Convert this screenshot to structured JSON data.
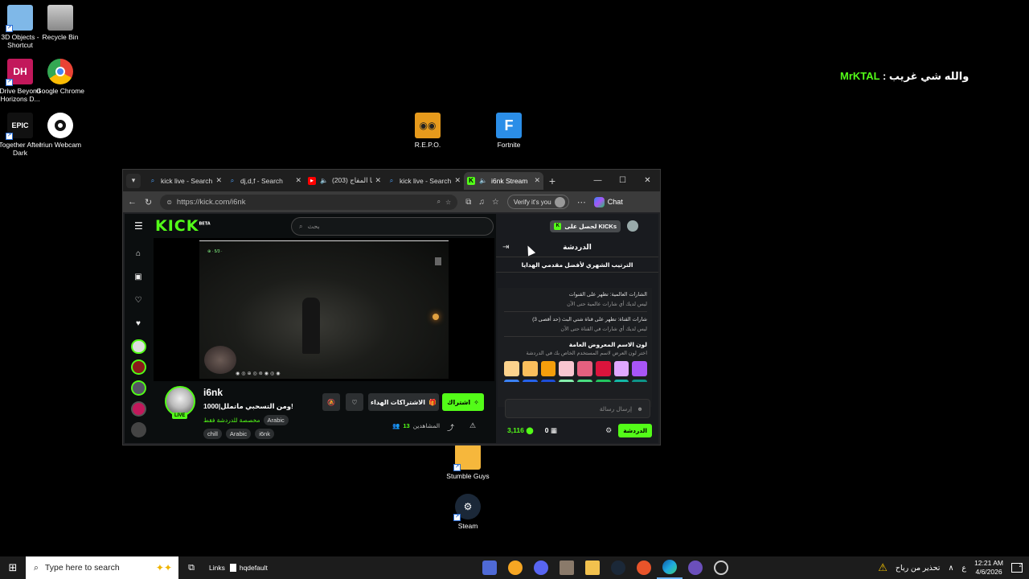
{
  "desktop": {
    "icons": [
      {
        "label": "3D Objects - Shortcut",
        "icon": "3d-objects-folder-icon"
      },
      {
        "label": "Recycle Bin",
        "icon": "recycle-bin-icon"
      },
      {
        "label": "Drive Beyond Horizons D...",
        "icon": "game-icon"
      },
      {
        "label": "Google Chrome",
        "icon": "chrome-icon"
      },
      {
        "label": "Together After Dark",
        "icon": "epic-games-icon"
      },
      {
        "label": "Iriun Webcam",
        "icon": "webcam-icon"
      },
      {
        "label": "R.E.P.O.",
        "icon": "repo-game-icon"
      },
      {
        "label": "Fortnite",
        "icon": "fortnite-icon"
      },
      {
        "label": "Stumble Guys",
        "icon": "stumble-guys-icon"
      },
      {
        "label": "Steam",
        "icon": "steam-icon"
      }
    ],
    "chat_overlay": {
      "name": "MrKTAL",
      "separator": " : ",
      "message": "والله شي غريب"
    }
  },
  "browser": {
    "tabs": [
      {
        "label": "kick live - Search",
        "icon": "search-icon",
        "active": false
      },
      {
        "label": "dj,d,f - Search",
        "icon": "search-icon",
        "active": false
      },
      {
        "label": "(203) انا المفاج",
        "icon": "youtube-icon",
        "active": false,
        "audio": true
      },
      {
        "label": "kick live - Search",
        "icon": "search-icon",
        "active": false
      },
      {
        "label": "i6nk Stream",
        "icon": "kick-icon",
        "active": true,
        "audio": true
      }
    ],
    "url": "https://kick.com/i6nk",
    "verify_label": "Verify it's you",
    "chat_label": "Chat"
  },
  "kick": {
    "logo": "KICK",
    "logo_beta": "BETA",
    "search_placeholder": "بحث",
    "stream": {
      "username": "i6nk",
      "live_badge": "LIVE",
      "title": "ومن التسحبي ماتملل|1000!",
      "category_prefix": "مخصصة للدردشة فقط",
      "language": "Arabic",
      "tags": [
        "chill",
        "Arabic",
        "i6nk"
      ],
      "follow_label": "اشتراك",
      "gift_label": "الاشتراكات الهداء",
      "viewers_label": "المشاهدين",
      "viewers_count": "13"
    },
    "chat": {
      "get_kicks": "لحصل على KICKs",
      "title": "الدردشة",
      "leaderboard": "الترتيب الشهري لأفضل مقدمي الهدايا",
      "global_badges_title": "الشارات العالمية: تظهر على القنوات",
      "global_badges_desc": "ليس لديك أي شارات عالمية حتى الآن",
      "channel_badges_title": "شارات القناة: تظهر على قناة شتي البث (حد أقصى 3)",
      "channel_badges_desc": "ليس لديك أي شارات في القناة حتى الآن",
      "name_color_title": "لون الاسم المعروض العامة",
      "name_color_desc": "اختر لون العرض لاسم المستخدم الخاص بك في الدردشة",
      "colors": [
        "#fcd38d",
        "#fbbf5c",
        "#f59e0b",
        "#f9c6d0",
        "#e5607f",
        "#dc143c",
        "#e0a8ff",
        "#a855f7"
      ],
      "colors_row2": [
        "#3b82f6",
        "#2563eb",
        "#1d4ed8",
        "#86efac",
        "#4ade80",
        "#22c55e",
        "#14b8a6",
        "#0d9488"
      ],
      "input_placeholder": "إرسال رسالة",
      "points": "3,116",
      "kicks": "0",
      "send_label": "الدردشة"
    }
  },
  "taskbar": {
    "search_placeholder": "Type here to search",
    "links_label": "Links",
    "hq_label": "hqdefault",
    "weather": "تحذير من رياح",
    "lang": "ع",
    "time": "12:21 AM",
    "date": "4/6/2026",
    "notifications": "2"
  }
}
